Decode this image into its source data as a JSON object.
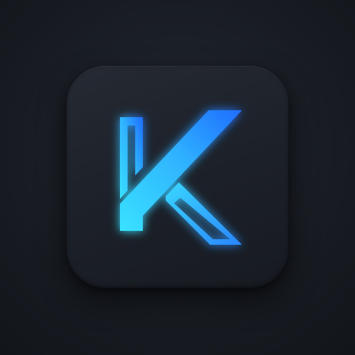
{
  "app_icon": {
    "logo_letter": "K",
    "icon_name": "letter-k-logo-icon",
    "colors": {
      "background": "#1a1e25",
      "tile": "#1f232b",
      "accent_light": "#39e2ff",
      "accent_dark": "#1f6dff",
      "glow": "#2a8cff"
    }
  }
}
